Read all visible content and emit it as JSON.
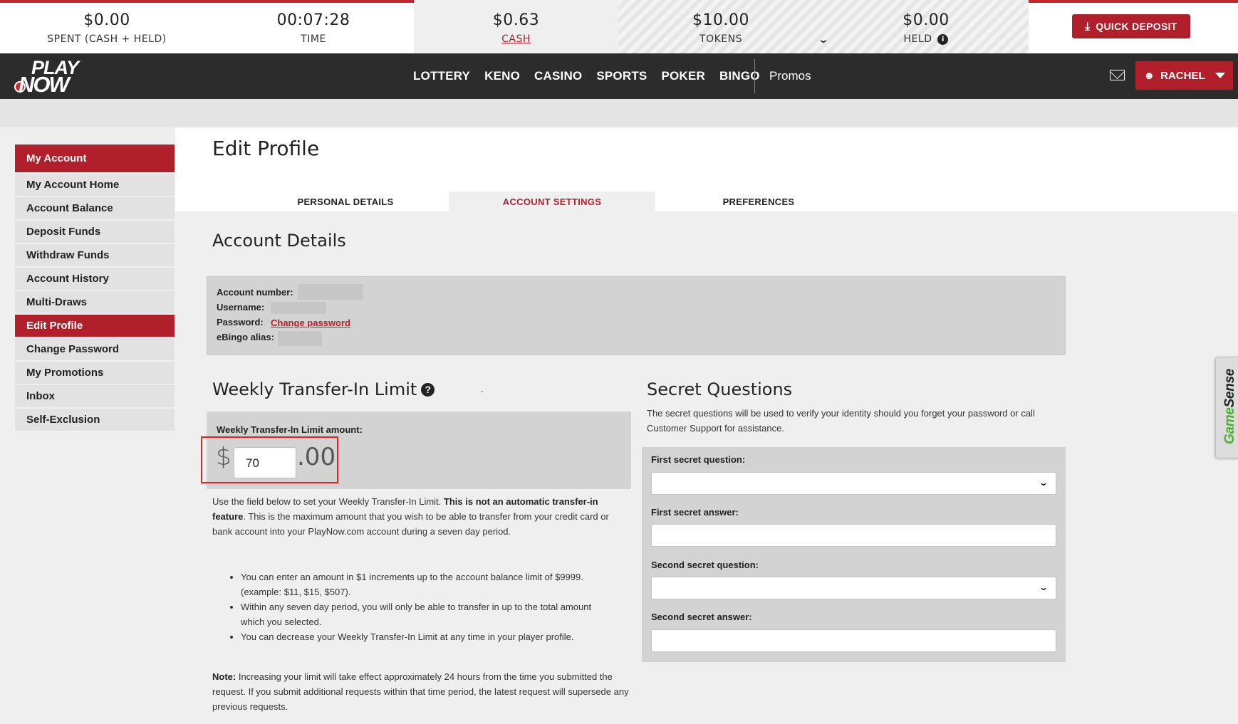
{
  "stats": {
    "spent": {
      "value": "$0.00",
      "label": "SPENT (CASH + HELD)"
    },
    "time": {
      "value": "00:07:28",
      "label": "TIME"
    },
    "cash": {
      "value": "$0.63",
      "label": "CASH"
    },
    "tokens": {
      "value": "$10.00",
      "label": "TOKENS"
    },
    "held": {
      "value": "$0.00",
      "label": "HELD"
    },
    "quick_deposit": "QUICK DEPOSIT"
  },
  "nav": {
    "logo": {
      "top": "PLAY",
      "bottom": "NOW"
    },
    "links": [
      "LOTTERY",
      "KENO",
      "CASINO",
      "SPORTS",
      "POKER",
      "BINGO"
    ],
    "promos": "Promos",
    "user": "RACHEL"
  },
  "sidebar": {
    "heading": "My Account",
    "items": [
      {
        "label": "My Account Home",
        "active": false
      },
      {
        "label": "Account Balance",
        "active": false
      },
      {
        "label": "Deposit Funds",
        "active": false
      },
      {
        "label": "Withdraw Funds",
        "active": false
      },
      {
        "label": "Account History",
        "active": false
      },
      {
        "label": "Multi-Draws",
        "active": false
      },
      {
        "label": "Edit Profile",
        "active": true
      },
      {
        "label": "Change Password",
        "active": false
      },
      {
        "label": "My Promotions",
        "active": false
      },
      {
        "label": "Inbox",
        "active": false
      },
      {
        "label": "Self-Exclusion",
        "active": false
      }
    ]
  },
  "page": {
    "title": "Edit Profile",
    "tabs": [
      "PERSONAL DETAILS",
      "ACCOUNT SETTINGS",
      "PREFERENCES"
    ],
    "active_tab": "ACCOUNT SETTINGS"
  },
  "account_details": {
    "heading": "Account Details",
    "account_number_label": "Account number:",
    "username_label": "Username:",
    "password_label": "Password:",
    "change_password_link": "Change password",
    "alias_label": "eBingo alias:"
  },
  "transfer_limit": {
    "heading": "Weekly Transfer-In Limit",
    "amount_label": "Weekly Transfer-In Limit amount:",
    "currency": "$",
    "amount": "70",
    "cents": ".00",
    "desc_pre": "Use the field below to set your Weekly Transfer-In Limit. ",
    "desc_bold": "This is not an automatic transfer-in feature",
    "desc_post": ". This is the maximum amount that you wish to be able to transfer from your credit card or bank account into your PlayNow.com account during a seven day period.",
    "bullets": [
      "You can enter an amount in $1 increments up to the account balance limit of $9999. (example: $11, $15, $507).",
      "Within any seven day period, you will only be able to transfer in up to the total amount which you selected.",
      "You can decrease your Weekly Transfer-In Limit at any time in your player profile."
    ],
    "note_label": "Note:",
    "note_text": " Increasing your limit will take effect approximately 24 hours from the time you submitted the request. If you submit additional requests within that time period, the latest request will supersede any previous requests."
  },
  "secret_questions": {
    "heading": "Secret Questions",
    "description": "The secret questions will be used to verify your identity should you forget your password or call Customer Support for assistance.",
    "q1_label": "First secret question:",
    "a1_label": "First secret answer:",
    "q2_label": "Second secret question:",
    "a2_label": "Second secret answer:"
  },
  "gamesense": {
    "part1": "Game",
    "part2": "Sense"
  },
  "colors": {
    "brand_red": "#b01f2a",
    "highlight": "#e3212a",
    "nav_bg": "#2c2c2c"
  }
}
